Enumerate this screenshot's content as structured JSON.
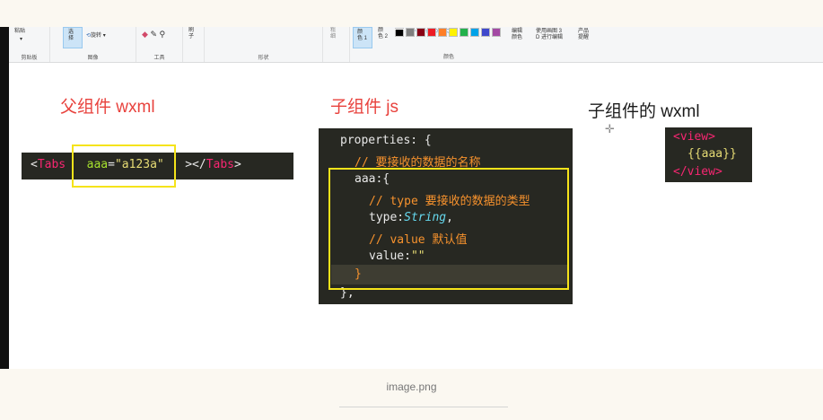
{
  "ribbon": {
    "paste_label": "粘贴",
    "clipboard_label": "剪贴板",
    "select_label": "选\n择",
    "rotate_label": "旋转",
    "image_label": "图像",
    "tools_label": "工具",
    "brush_label": "刷\n子",
    "shapes_label": "形状",
    "size_label": "粗\n细",
    "color1_label": "颜\n色 1",
    "color2_label": "颜\n色 2",
    "colors_label": "颜色",
    "edit_colors_label": "编辑\n颜色",
    "paint3d_label": "使用画图 3\nD 进行编辑",
    "product_alert_label": "产品\n提醒",
    "swatch_colors": [
      "#000000",
      "#7f7f7f",
      "#880015",
      "#ed1c24",
      "#ff7f27",
      "#fff200",
      "#22b14c",
      "#00a2e8",
      "#3f48cc",
      "#a349a4"
    ]
  },
  "headings": {
    "parent_wxml": "父组件 wxml",
    "child_js": "子组件 js",
    "child_wxml": "子组件的 wxml"
  },
  "parent_code": {
    "open_lt": "<",
    "tag": "Tabs",
    "attr": "aaa",
    "eq": "=",
    "value": "\"a123a\"",
    "close": "></",
    "close_tag": "Tabs",
    "close_gt": ">"
  },
  "js_code": {
    "line1": "properties: {",
    "line2": "// 要接收的数据的名称",
    "line3": "aaa:{",
    "line4": "// type  要接收的数据的类型",
    "line5_key": "type:",
    "line5_val": "String",
    "line5_end": ",",
    "line6": "// value  默认值",
    "line7_key": "value:",
    "line7_val": "\"\"",
    "line8": "}",
    "line9": "},"
  },
  "child_code": {
    "open": "<view>",
    "body": "{{aaa}}",
    "close": "</view>"
  },
  "caption": "image.png"
}
